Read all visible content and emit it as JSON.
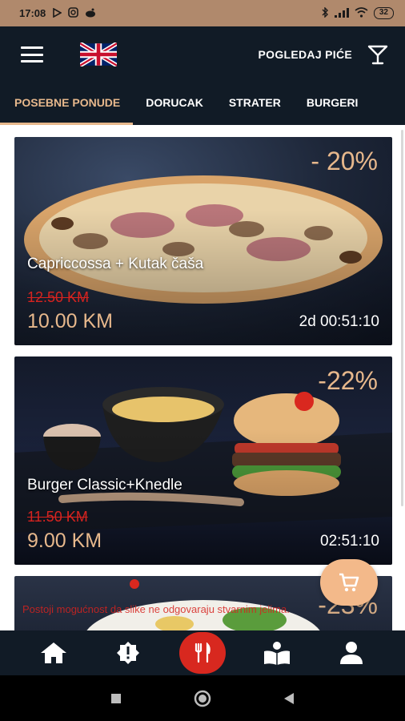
{
  "status_bar": {
    "time": "17:08",
    "battery": "32"
  },
  "header": {
    "language_flag": "uk-flag-icon",
    "drinks_link": "POGLEDAJ PIĆE"
  },
  "tabs": [
    {
      "label": "POSEBNE PONUDE",
      "active": true
    },
    {
      "label": "DORUCAK",
      "active": false
    },
    {
      "label": "STRATER",
      "active": false
    },
    {
      "label": "BURGERI",
      "active": false
    }
  ],
  "offers": [
    {
      "title": "Capriccossa + Kutak čaša",
      "discount": "- 20%",
      "old_price": "12.50 KM",
      "new_price": "10.00 KM",
      "timer": "2d 00:51:10"
    },
    {
      "title": "Burger Classic+Knedle",
      "discount": "-22%",
      "old_price": "11.50 KM",
      "new_price": "9.00 KM",
      "timer": "02:51:10"
    },
    {
      "discount": "-23%",
      "notice": "Postoji mogućnost da slike ne odgovaraju stvarnim jelima."
    }
  ],
  "colors": {
    "accent": "#e7b88c",
    "header_bg": "#111b26",
    "old_price": "#d6231f",
    "nav_center": "#d8281f",
    "status_bar": "#b0896c",
    "cart_fab": "#f3b98a"
  },
  "bottom_nav": [
    "home-icon",
    "alert-badge-icon",
    "menu-utensils-icon",
    "reader-icon",
    "profile-icon"
  ]
}
